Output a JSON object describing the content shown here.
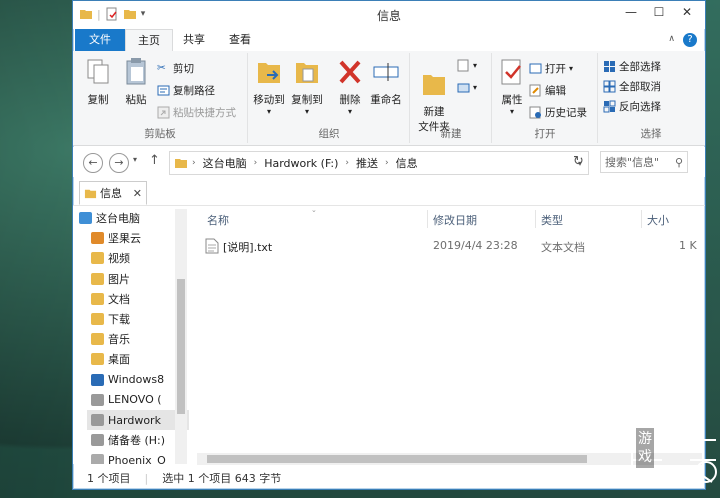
{
  "window": {
    "title": "信息"
  },
  "ribbon_tabs": {
    "file": "文件",
    "home": "主页",
    "share": "共享",
    "view": "查看"
  },
  "ribbon": {
    "clipboard": {
      "copy": "复制",
      "paste": "粘贴",
      "cut": "剪切",
      "copy_path": "复制路径",
      "paste_shortcut": "粘贴快捷方式",
      "label": "剪贴板"
    },
    "organize": {
      "move_to": "移动到",
      "copy_to": "复制到",
      "delete": "删除",
      "rename": "重命名",
      "label": "组织"
    },
    "new": {
      "new_folder": "新建\n文件夹",
      "label": "新建"
    },
    "open": {
      "properties": "属性",
      "open": "打开",
      "edit": "编辑",
      "history": "历史记录",
      "label": "打开"
    },
    "select": {
      "select_all": "全部选择",
      "select_none": "全部取消",
      "invert": "反向选择",
      "label": "选择"
    }
  },
  "address": {
    "crumbs": [
      "这台电脑",
      "Hardwork (F:)",
      "推送",
      "信息"
    ]
  },
  "search": {
    "placeholder": "搜索\"信息\""
  },
  "doc_tab": {
    "label": "信息"
  },
  "nav_pane": {
    "items": [
      {
        "label": "这台电脑",
        "icon": "computer-icon"
      },
      {
        "label": "坚果云",
        "icon": "nut-icon"
      },
      {
        "label": "视频",
        "icon": "video-folder-icon"
      },
      {
        "label": "图片",
        "icon": "pictures-folder-icon"
      },
      {
        "label": "文档",
        "icon": "documents-folder-icon"
      },
      {
        "label": "下载",
        "icon": "downloads-folder-icon"
      },
      {
        "label": "音乐",
        "icon": "music-folder-icon"
      },
      {
        "label": "桌面",
        "icon": "desktop-folder-icon"
      },
      {
        "label": "Windows8",
        "icon": "windows-drive-icon"
      },
      {
        "label": "LENOVO (",
        "icon": "drive-icon"
      },
      {
        "label": "Hardwork",
        "icon": "drive-icon"
      },
      {
        "label": "储备卷 (H:)",
        "icon": "drive-icon"
      },
      {
        "label": "Phoenix_O",
        "icon": "disc-icon"
      }
    ]
  },
  "columns": {
    "name": "名称",
    "date": "修改日期",
    "type": "类型",
    "size": "大小"
  },
  "files": [
    {
      "name": "[说明].txt",
      "date": "2019/4/4 23:28",
      "type": "文本文档",
      "size": "1 K"
    }
  ],
  "status": {
    "count": "1 个项目",
    "selection": "选中 1 个项目  643 字节"
  },
  "watermark": {
    "text1": "游",
    "text2": "戏"
  },
  "colors": {
    "accent": "#1979ca",
    "selection": "#e5e5e5"
  }
}
